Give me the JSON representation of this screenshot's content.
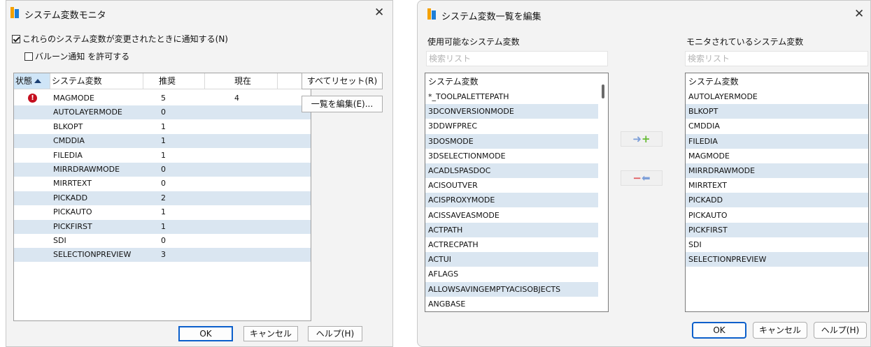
{
  "monitor": {
    "title": "システム変数モニタ",
    "close_glyph": "✕",
    "notify_label": "これらのシステム変数が変更されたときに通知する(N)",
    "notify_checked": true,
    "balloon_label": "バルーン通知 を許可する",
    "balloon_checked": false,
    "columns": [
      "状態",
      "システム変数",
      "推奨",
      "現在"
    ],
    "rows": [
      {
        "status": "!",
        "name": "MAGMODE",
        "recommended": "5",
        "current": "4"
      },
      {
        "status": "",
        "name": "AUTOLAYERMODE",
        "recommended": "0",
        "current": ""
      },
      {
        "status": "",
        "name": "BLKOPT",
        "recommended": "1",
        "current": ""
      },
      {
        "status": "",
        "name": "CMDDIA",
        "recommended": "1",
        "current": ""
      },
      {
        "status": "",
        "name": "FILEDIA",
        "recommended": "1",
        "current": ""
      },
      {
        "status": "",
        "name": "MIRRDRAWMODE",
        "recommended": "0",
        "current": ""
      },
      {
        "status": "",
        "name": "MIRRTEXT",
        "recommended": "0",
        "current": ""
      },
      {
        "status": "",
        "name": "PICKADD",
        "recommended": "2",
        "current": ""
      },
      {
        "status": "",
        "name": "PICKAUTO",
        "recommended": "1",
        "current": ""
      },
      {
        "status": "",
        "name": "PICKFIRST",
        "recommended": "1",
        "current": ""
      },
      {
        "status": "",
        "name": "SDI",
        "recommended": "0",
        "current": ""
      },
      {
        "status": "",
        "name": "SELECTIONPREVIEW",
        "recommended": "3",
        "current": ""
      }
    ],
    "reset_all_label": "すべてリセット(R)",
    "edit_list_label": "一覧を編集(E)...",
    "ok_label": "OK",
    "cancel_label": "キャンセル",
    "help_label": "ヘルプ(H)"
  },
  "editor": {
    "title": "システム変数一覧を編集",
    "close_glyph": "✕",
    "available_label": "使用可能なシステム変数",
    "monitored_label": "モニタされているシステム変数",
    "search_placeholder": "検索リスト",
    "list_header": "システム変数",
    "available": [
      "*_TOOLPALETTEPATH",
      "3DCONVERSIONMODE",
      "3DDWFPREC",
      "3DOSMODE",
      "3DSELECTIONMODE",
      "ACADLSPASDOC",
      "ACISOUTVER",
      "ACISPROXYMODE",
      "ACISSAVEASMODE",
      "ACTPATH",
      "ACTRECPATH",
      "ACTUI",
      "AFLAGS",
      "ALLOWSAVINGEMPTYACISOBJECTS",
      "ANGBASE"
    ],
    "monitored": [
      "AUTOLAYERMODE",
      "BLKOPT",
      "CMDDIA",
      "FILEDIA",
      "MAGMODE",
      "MIRRDRAWMODE",
      "MIRRTEXT",
      "PICKADD",
      "PICKAUTO",
      "PICKFIRST",
      "SDI",
      "SELECTIONPREVIEW"
    ],
    "add_glyphs": [
      "➜",
      "+"
    ],
    "remove_glyphs": [
      "−",
      "⬅"
    ],
    "ok_label": "OK",
    "cancel_label": "キャンセル",
    "help_label": "ヘルプ(H)"
  },
  "colors": {
    "alt_row": "#dae6f1",
    "warning": "#c50f1f",
    "accent": "#0b5fcb"
  }
}
